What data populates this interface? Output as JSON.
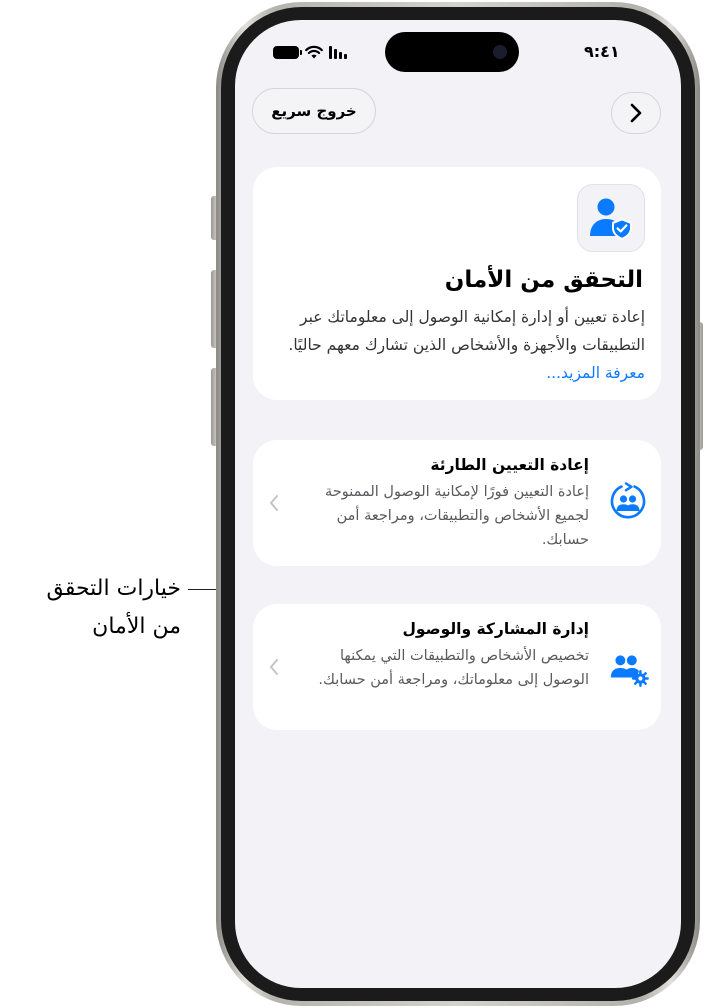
{
  "status_bar": {
    "time": "٩:٤١"
  },
  "nav": {
    "quick_exit_label": "خروج سريع",
    "forward_icon": "chevron-right-icon"
  },
  "header_card": {
    "icon": "person-checkmark-shield-icon",
    "title": "التحقق من الأمان",
    "description": "إعادة تعيين أو إدارة إمكانية الوصول إلى معلوماتك عبر التطبيقات والأجهزة والأشخاص الذين تشارك معهم حاليًا.",
    "learn_more": "معرفة المزيد..."
  },
  "options": [
    {
      "icon": "people-reset-icon",
      "title": "إعادة التعيين الطارئة",
      "description": "إعادة التعيين فورًا لإمكانية الوصول الممنوحة لجميع الأشخاص والتطبيقات، ومراجعة أمن حسابك."
    },
    {
      "icon": "people-gear-icon",
      "title": "إدارة المشاركة والوصول",
      "description": "تخصيص الأشخاص والتطبيقات التي يمكنها الوصول إلى معلوماتك، ومراجعة أمن حسابك."
    }
  ],
  "annotation": {
    "line1": "خيارات التحقق",
    "line2": "من الأمان"
  },
  "colors": {
    "accent": "#0a7aff",
    "screen_bg": "#f2f2f7",
    "card_bg": "#ffffff"
  }
}
